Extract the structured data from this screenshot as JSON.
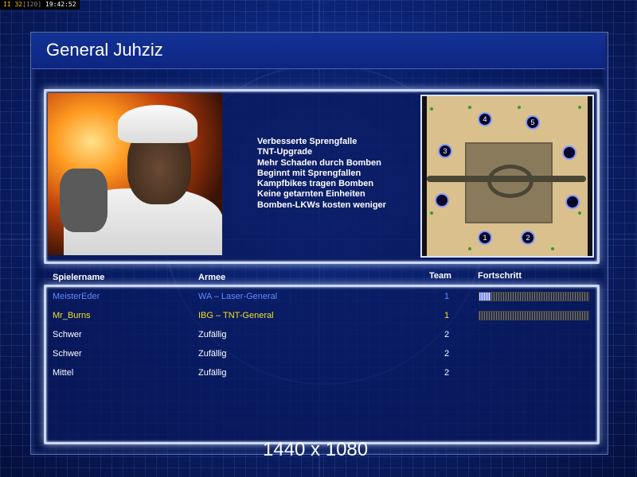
{
  "status_bar": {
    "prefix": "II",
    "value": "32",
    "bracket": "[120]",
    "time": "19:42:52"
  },
  "title": "General Juhziz",
  "traits": [
    "Verbesserte Sprengfalle",
    "TNT-Upgrade",
    "Mehr Schaden durch Bomben",
    "Beginnt mit Sprengfallen",
    "Kampfbikes tragen Bomben",
    "Keine getarnten Einheiten",
    "Bomben-LKWs kosten weniger"
  ],
  "minimap": {
    "spawns": [
      "4",
      "5",
      "3",
      "",
      "",
      "",
      "1",
      "2"
    ]
  },
  "table": {
    "headers": {
      "name": "Spielername",
      "army": "Armee",
      "team": "Team",
      "progress": "Fortschritt"
    },
    "rows": [
      {
        "name": "MeisterEder",
        "army": "WA – Laser-General",
        "team": "1",
        "color": "#5f8cff",
        "progress": 0.1
      },
      {
        "name": "Mr_Burns",
        "army": "IBG – TNT-General",
        "team": "1",
        "color": "#f0e020",
        "progress": 0.0
      },
      {
        "name": "Schwer",
        "army": "Zufällig",
        "team": "2",
        "color": "#ffffff"
      },
      {
        "name": "Schwer",
        "army": "Zufällig",
        "team": "2",
        "color": "#ffffff"
      },
      {
        "name": "Mittel",
        "army": "Zufällig",
        "team": "2",
        "color": "#ffffff"
      }
    ]
  },
  "resolution": "1440 x 1080"
}
